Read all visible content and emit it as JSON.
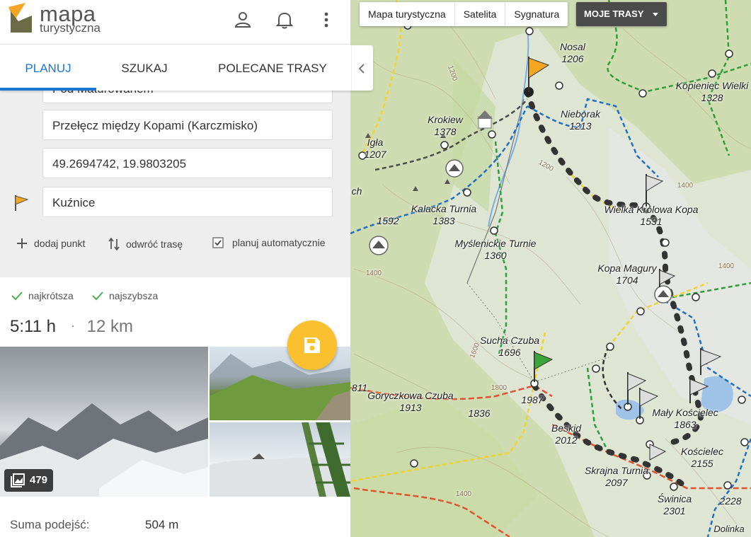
{
  "app": {
    "logo_line1": "mapa",
    "logo_line2": "turystyczna",
    "brand_color": "#f5a623"
  },
  "header": {
    "icons": [
      "user-icon",
      "bell-icon",
      "more-vert-icon"
    ]
  },
  "tabs": [
    {
      "label": "PLANUJ",
      "active": true
    },
    {
      "label": "SZUKAJ",
      "active": false
    },
    {
      "label": "POLECANE TRASY",
      "active": false
    }
  ],
  "planner": {
    "waypoints": [
      {
        "value": "Pod Maturowanem"
      },
      {
        "value": "Przełęcz między Kopami (Karczmisko)"
      },
      {
        "value": "49.2694742, 19.9803205"
      },
      {
        "value": "Kuźnice"
      }
    ],
    "add_point": "dodaj punkt",
    "reverse_route": "odwróć trasę",
    "auto_plan": "planuj automatycznie",
    "auto_plan_checked": true
  },
  "route": {
    "options": [
      "najkrótsza",
      "najszybsza"
    ],
    "duration": "5:11 h",
    "separator": "·",
    "distance": "12 km",
    "photo_count": "479",
    "stats": [
      {
        "label": "Suma podejść:",
        "value": "504 m"
      }
    ]
  },
  "map": {
    "layers": [
      "Mapa turystyczna",
      "Satelita",
      "Sygnatura"
    ],
    "my_routes": "MOJE TRASY",
    "peaks": [
      {
        "name": "Nosal",
        "elev": "1206"
      },
      {
        "name": "Kopieniec Wielki",
        "elev": "1328"
      },
      {
        "name": "Krokiew",
        "elev": "1378"
      },
      {
        "name": "Nieborak",
        "elev": "1213"
      },
      {
        "name": "Igła",
        "elev": "1207"
      },
      {
        "name": "Kalacka Turnia",
        "elev": "1383"
      },
      {
        "name": "Wielka Królowa Kopa",
        "elev": "1531"
      },
      {
        "name": "Myślenickie Turnie",
        "elev": "1360"
      },
      {
        "name": "Kopa Magury",
        "elev": "1704"
      },
      {
        "name": "Sucha Czuba",
        "elev": "1696"
      },
      {
        "name": "Goryczkowa Czuba",
        "elev": "1913"
      },
      {
        "name": "Mały Kościelec",
        "elev": "1863"
      },
      {
        "name": "Beskid",
        "elev": "2012"
      },
      {
        "name": "Kościelec",
        "elev": "2155"
      },
      {
        "name": "Skrajna Turnia",
        "elev": "2097"
      },
      {
        "name": "Świnica",
        "elev": "2301"
      }
    ],
    "spot_heights": [
      "1592",
      "1836",
      "1987",
      "811",
      "2228"
    ],
    "contour_labels": [
      "1200",
      "1400",
      "1600",
      "1800"
    ],
    "places": [
      "Dolinka",
      "ch"
    ]
  }
}
